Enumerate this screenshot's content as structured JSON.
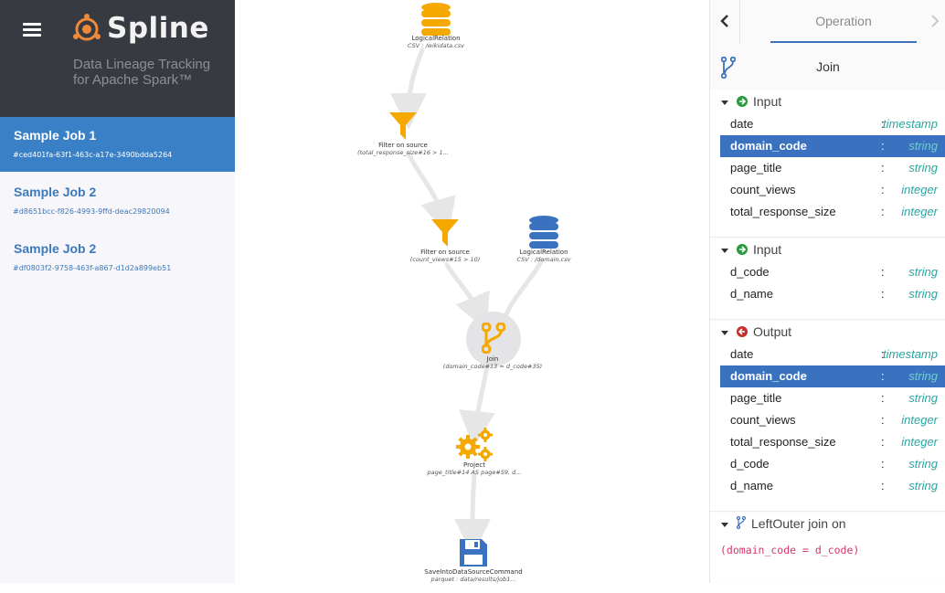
{
  "app": {
    "name": "Spline",
    "subtitle_line1": "Data Lineage Tracking",
    "subtitle_line2": "for Apache Spark™"
  },
  "jobs": [
    {
      "title": "Sample Job 1",
      "id": "#ced401fa-63f1-463c-a17e-3490bdda5264",
      "active": true
    },
    {
      "title": "Sample Job 2",
      "id": "#d8651bcc-f826-4993-9ffd-deac29820094",
      "active": false
    },
    {
      "title": "Sample Job 2",
      "id": "#df0803f2-9758-463f-a867-d1d2a899eb51",
      "active": false
    }
  ],
  "graph": {
    "nodes": [
      {
        "name": "LogicalRelation",
        "sub": "CSV : /wikidata.csv",
        "icon": "database-icon",
        "color": "#f5a800"
      },
      {
        "name": "Filter on source",
        "sub": "(total_response_size#16 > 1...",
        "icon": "filter-icon",
        "color": "#f5a800"
      },
      {
        "name": "Filter on source",
        "sub": "(count_views#15 > 10)",
        "icon": "filter-icon",
        "color": "#f5a800"
      },
      {
        "name": "LogicalRelation",
        "sub": "CSV : /domain.csv",
        "icon": "database-icon",
        "color": "#3a72c0"
      },
      {
        "name": "Join",
        "sub": "(domain_code#13 = d_code#35)",
        "icon": "join-icon",
        "color": "#f5a800"
      },
      {
        "name": "Project",
        "sub": "page_title#14 AS page#59, d...",
        "icon": "gears-icon",
        "color": "#f5a800"
      },
      {
        "name": "SaveIntoDataSourceCommand",
        "sub": "parquet : data/results/job1...",
        "icon": "save-icon",
        "color": "#3a72c0"
      }
    ]
  },
  "panel": {
    "tab_label": "Operation",
    "operation_title": "Join",
    "colors": {
      "accent": "#3a72c0",
      "type": "#2aa6a0",
      "input": "#2b9a3f",
      "output": "#c0302b",
      "condition": "#d6336c"
    },
    "input1": {
      "label": "Input",
      "rows": [
        {
          "name": "date",
          "type": "timestamp"
        },
        {
          "name": "domain_code",
          "type": "string",
          "highlight": true
        },
        {
          "name": "page_title",
          "type": "string"
        },
        {
          "name": "count_views",
          "type": "integer"
        },
        {
          "name": "total_response_size",
          "type": "integer"
        }
      ]
    },
    "input2": {
      "label": "Input",
      "rows": [
        {
          "name": "d_code",
          "type": "string"
        },
        {
          "name": "d_name",
          "type": "string"
        }
      ]
    },
    "output": {
      "label": "Output",
      "rows": [
        {
          "name": "date",
          "type": "timestamp"
        },
        {
          "name": "domain_code",
          "type": "string",
          "highlight": true
        },
        {
          "name": "page_title",
          "type": "string"
        },
        {
          "name": "count_views",
          "type": "integer"
        },
        {
          "name": "total_response_size",
          "type": "integer"
        },
        {
          "name": "d_code",
          "type": "string"
        },
        {
          "name": "d_name",
          "type": "string"
        }
      ]
    },
    "join": {
      "label": "LeftOuter join on",
      "condition": "(domain_code = d_code)"
    },
    "colon": ":"
  }
}
